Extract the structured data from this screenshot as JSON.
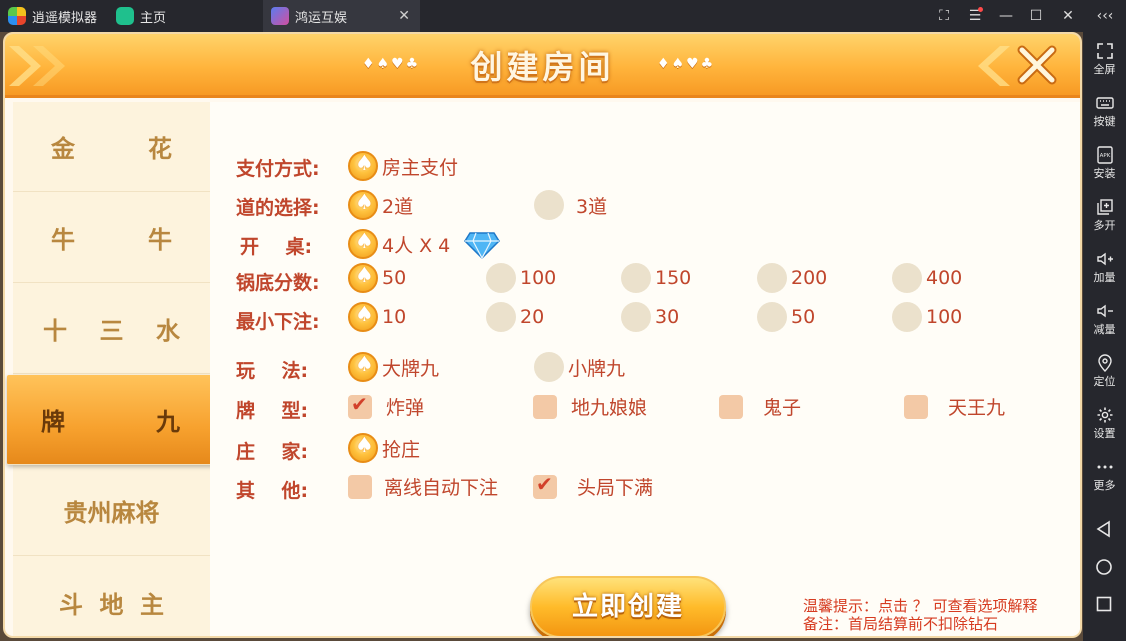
{
  "titlebar": {
    "app_name": "逍遥模拟器",
    "home_tab": "主页",
    "game_tab": "鸿运互娱",
    "close_tab": "✕",
    "controls": {
      "fullscreen": "⛶",
      "menu": "☰",
      "minimize": "—",
      "maximize": "☐",
      "close": "✕",
      "collapse": "‹‹‹"
    }
  },
  "sidebar": {
    "items": [
      {
        "label": "全屏",
        "icon": "fullscreen-icon"
      },
      {
        "label": "按键",
        "icon": "keyboard-icon"
      },
      {
        "label": "安装",
        "icon": "apk-icon"
      },
      {
        "label": "多开",
        "icon": "multi-instance-icon"
      },
      {
        "label": "加量",
        "icon": "volume-up-icon"
      },
      {
        "label": "减量",
        "icon": "volume-down-icon"
      },
      {
        "label": "定位",
        "icon": "location-icon"
      },
      {
        "label": "设置",
        "icon": "gear-icon"
      },
      {
        "label": "更多",
        "icon": "more-icon"
      }
    ],
    "nav": [
      "back-icon",
      "home-icon",
      "recent-apps-icon"
    ]
  },
  "game": {
    "title": "创建房间",
    "suits_left": "♦♠♥♣",
    "suits_right": "♦♠♥♣",
    "tabs": [
      {
        "left": "金",
        "right": "花"
      },
      {
        "left": "牛",
        "right": "牛"
      },
      {
        "left": "十",
        "middle": "三",
        "right": "水"
      },
      {
        "left": "牌",
        "right": "九",
        "active": true
      },
      {
        "full": "贵州麻将"
      },
      {
        "left": "斗",
        "middle": "地",
        "right": "主"
      }
    ],
    "rows": {
      "payment": {
        "label": "支付方式:",
        "options": [
          "房主支付"
        ]
      },
      "rounds": {
        "label": "道的选择:",
        "options": [
          "2道",
          "3道"
        ]
      },
      "tables": {
        "label": "开    桌:",
        "options": [
          "4人  X 4"
        ]
      },
      "base_score": {
        "label": "锅底分数:",
        "options": [
          "50",
          "100",
          "150",
          "200",
          "400"
        ]
      },
      "min_bet": {
        "label": "最小下注:",
        "options": [
          "10",
          "20",
          "30",
          "50",
          "100"
        ]
      },
      "play": {
        "label": "玩    法:",
        "options": [
          "大牌九",
          "小牌九"
        ]
      },
      "card_type": {
        "label": "牌    型:",
        "options": [
          "炸弹",
          "地九娘娘",
          "鬼子",
          "天王九"
        ]
      },
      "banker": {
        "label": "庄    家:",
        "options": [
          "抢庄"
        ]
      },
      "other": {
        "label": "其    他:",
        "options": [
          "离线自动下注",
          "头局下满"
        ]
      }
    },
    "create_button": "立即创建",
    "tip_1": "温馨提示：点击 ？  可查看选项解释",
    "tip_2": "备注：首局结算前不扣除钻石"
  },
  "colors": {
    "accent": "#f7a12e",
    "label_red": "#c0462c",
    "sidebar_bg": "#26272d"
  }
}
